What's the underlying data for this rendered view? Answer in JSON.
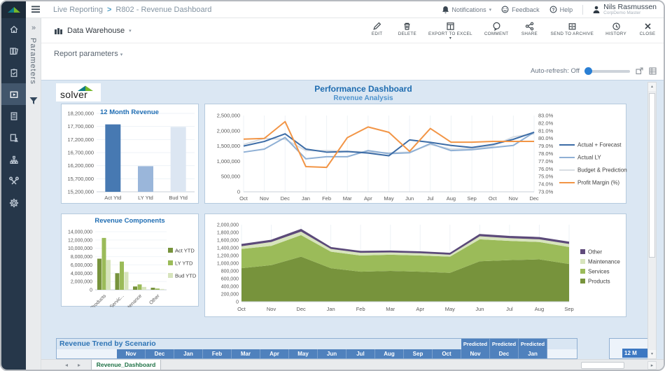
{
  "header": {
    "breadcrumb": {
      "section": "Live Reporting",
      "separator": ">",
      "page": "R802 - Revenue Dashboard"
    },
    "notifications": "Notifications",
    "feedback": "Feedback",
    "help": "Help",
    "user": {
      "name": "Nils Rasmussen",
      "role": "CorpDemo Master"
    }
  },
  "sidebar": {
    "icons": [
      "home",
      "reporting",
      "tasks",
      "report-viewer",
      "budgeting",
      "consolidation",
      "process",
      "tools",
      "settings"
    ],
    "selected": "report-viewer"
  },
  "parameters_panel": {
    "label": "Parameters",
    "expand_chevrons": "»"
  },
  "toolbar": {
    "source": "Data Warehouse",
    "actions": [
      "EDIT",
      "DELETE",
      "EXPORT TO EXCEL",
      "COMMENT",
      "SHARE",
      "SEND TO ARCHIVE",
      "HISTORY",
      "CLOSE"
    ]
  },
  "report_bar": {
    "label": "Report parameters"
  },
  "refresh": {
    "label": "Auto-refresh: Off"
  },
  "sheet": {
    "logo": "solver",
    "title": "Performance Dashboard",
    "subtitle": "Revenue Analysis",
    "tab": "Revenue_Dashboard"
  },
  "table": {
    "title": "Revenue Trend by Scenario",
    "months": [
      "Nov",
      "Dec",
      "Jan",
      "Feb",
      "Mar",
      "Apr",
      "May",
      "Jun",
      "Jul",
      "Aug",
      "Sep",
      "Oct"
    ],
    "predicted_label": "Predicted",
    "predicted_months": [
      "Nov",
      "Dec",
      "Jan"
    ],
    "corner_cell": "12 M"
  },
  "colors": {
    "accent_blue": "#2e74b5",
    "table_header_blue": "#4f81bd",
    "sheet_bg": "#dbe7f3",
    "sidebar_bg": "#26374a",
    "logo_teal": "#0e7c86",
    "logo_green": "#76b82a",
    "excel_tab_green": "#1e7145"
  },
  "chart_data": [
    {
      "type": "bar",
      "title": "12 Month Revenue",
      "categories": [
        "Act Ytd",
        "LY Ytd",
        "Bud Ytd"
      ],
      "values": [
        17780000,
        16180000,
        17680000
      ],
      "bar_colors": [
        "#4779b2",
        "#9ab6da",
        "#dce6f2"
      ],
      "ylim": [
        15200000,
        18200000
      ],
      "ytick_step": 500000
    },
    {
      "type": "line",
      "x": [
        "Oct",
        "Nov",
        "Dec",
        "Jan",
        "Feb",
        "Mar",
        "Apr",
        "May",
        "Jun",
        "Jul",
        "Aug",
        "Sep",
        "Oct",
        "Nov",
        "Dec"
      ],
      "ylim_left": [
        0,
        2500000
      ],
      "ytick_step_left": 500000,
      "ylim_right": [
        73,
        83
      ],
      "ytick_step_right": 1,
      "legend_position": "right",
      "series": [
        {
          "name": "Actual + Forecast",
          "color": "#3c6ca6",
          "axis": "left",
          "values": [
            1500000,
            1650000,
            1900000,
            1400000,
            1300000,
            1320000,
            1270000,
            1180000,
            1700000,
            1620000,
            1520000,
            1450000,
            1550000,
            1720000,
            1950000
          ]
        },
        {
          "name": "Actual LY",
          "color": "#8fb0d5",
          "axis": "left",
          "values": [
            1300000,
            1400000,
            1780000,
            1080000,
            1150000,
            1150000,
            1350000,
            1250000,
            1280000,
            1580000,
            1350000,
            1380000,
            1450000,
            1520000,
            1950000
          ]
        },
        {
          "name": "Budget & Prediction",
          "color": "#d8dde3",
          "axis": "left",
          "values": [
            1550000,
            1750000,
            1720000,
            1350000,
            1350000,
            1330000,
            1300000,
            1280000,
            1300000,
            1550000,
            1400000,
            1420000,
            1500000,
            1800000,
            1900000
          ]
        },
        {
          "name": "Profit Margin (%)",
          "color": "#f29546",
          "axis": "right",
          "values": [
            79.9,
            80.0,
            82.2,
            76.3,
            76.2,
            80.1,
            81.5,
            80.8,
            78.3,
            81.3,
            79.5,
            79.5,
            79.6,
            79.6,
            79.6
          ]
        }
      ]
    },
    {
      "type": "bar",
      "title": "Revenue Components",
      "categories": [
        "Products",
        "Servic...",
        "Maintenance",
        "Other"
      ],
      "ylim": [
        0,
        14000000
      ],
      "ytick_step": 2000000,
      "legend_position": "right",
      "series": [
        {
          "name": "Act YTD",
          "color": "#77933c",
          "values": [
            7500000,
            4000000,
            800000,
            500000
          ]
        },
        {
          "name": "LY YTD",
          "color": "#9bbb59",
          "values": [
            12500000,
            6800000,
            1300000,
            300000
          ]
        },
        {
          "name": "Bud YTD",
          "color": "#d7e4bc",
          "values": [
            7200000,
            4300000,
            700000,
            200000
          ]
        }
      ]
    },
    {
      "type": "area",
      "x": [
        "Oct",
        "Nov",
        "Dec",
        "Jan",
        "Feb",
        "Mar",
        "Apr",
        "May",
        "Jun",
        "Jul",
        "Aug",
        "Sep"
      ],
      "ylim": [
        0,
        2000000
      ],
      "ytick_step": 200000,
      "legend_position": "right",
      "series": [
        {
          "name": "Products",
          "color": "#77933c",
          "values": [
            870000,
            950000,
            1170000,
            870000,
            780000,
            800000,
            780000,
            750000,
            1050000,
            1080000,
            1100000,
            980000
          ]
        },
        {
          "name": "Services",
          "color": "#9bbb59",
          "values": [
            500000,
            500000,
            560000,
            430000,
            420000,
            420000,
            420000,
            420000,
            570000,
            500000,
            450000,
            440000
          ]
        },
        {
          "name": "Maintenance",
          "color": "#d7e4bc",
          "values": [
            70000,
            100000,
            90000,
            70000,
            70000,
            60000,
            60000,
            50000,
            80000,
            70000,
            70000,
            80000
          ]
        },
        {
          "name": "Other",
          "color": "#604a7b",
          "line": "#5b4a79",
          "values": [
            40000,
            40000,
            50000,
            30000,
            30000,
            30000,
            30000,
            30000,
            40000,
            40000,
            40000,
            40000
          ]
        }
      ]
    }
  ]
}
